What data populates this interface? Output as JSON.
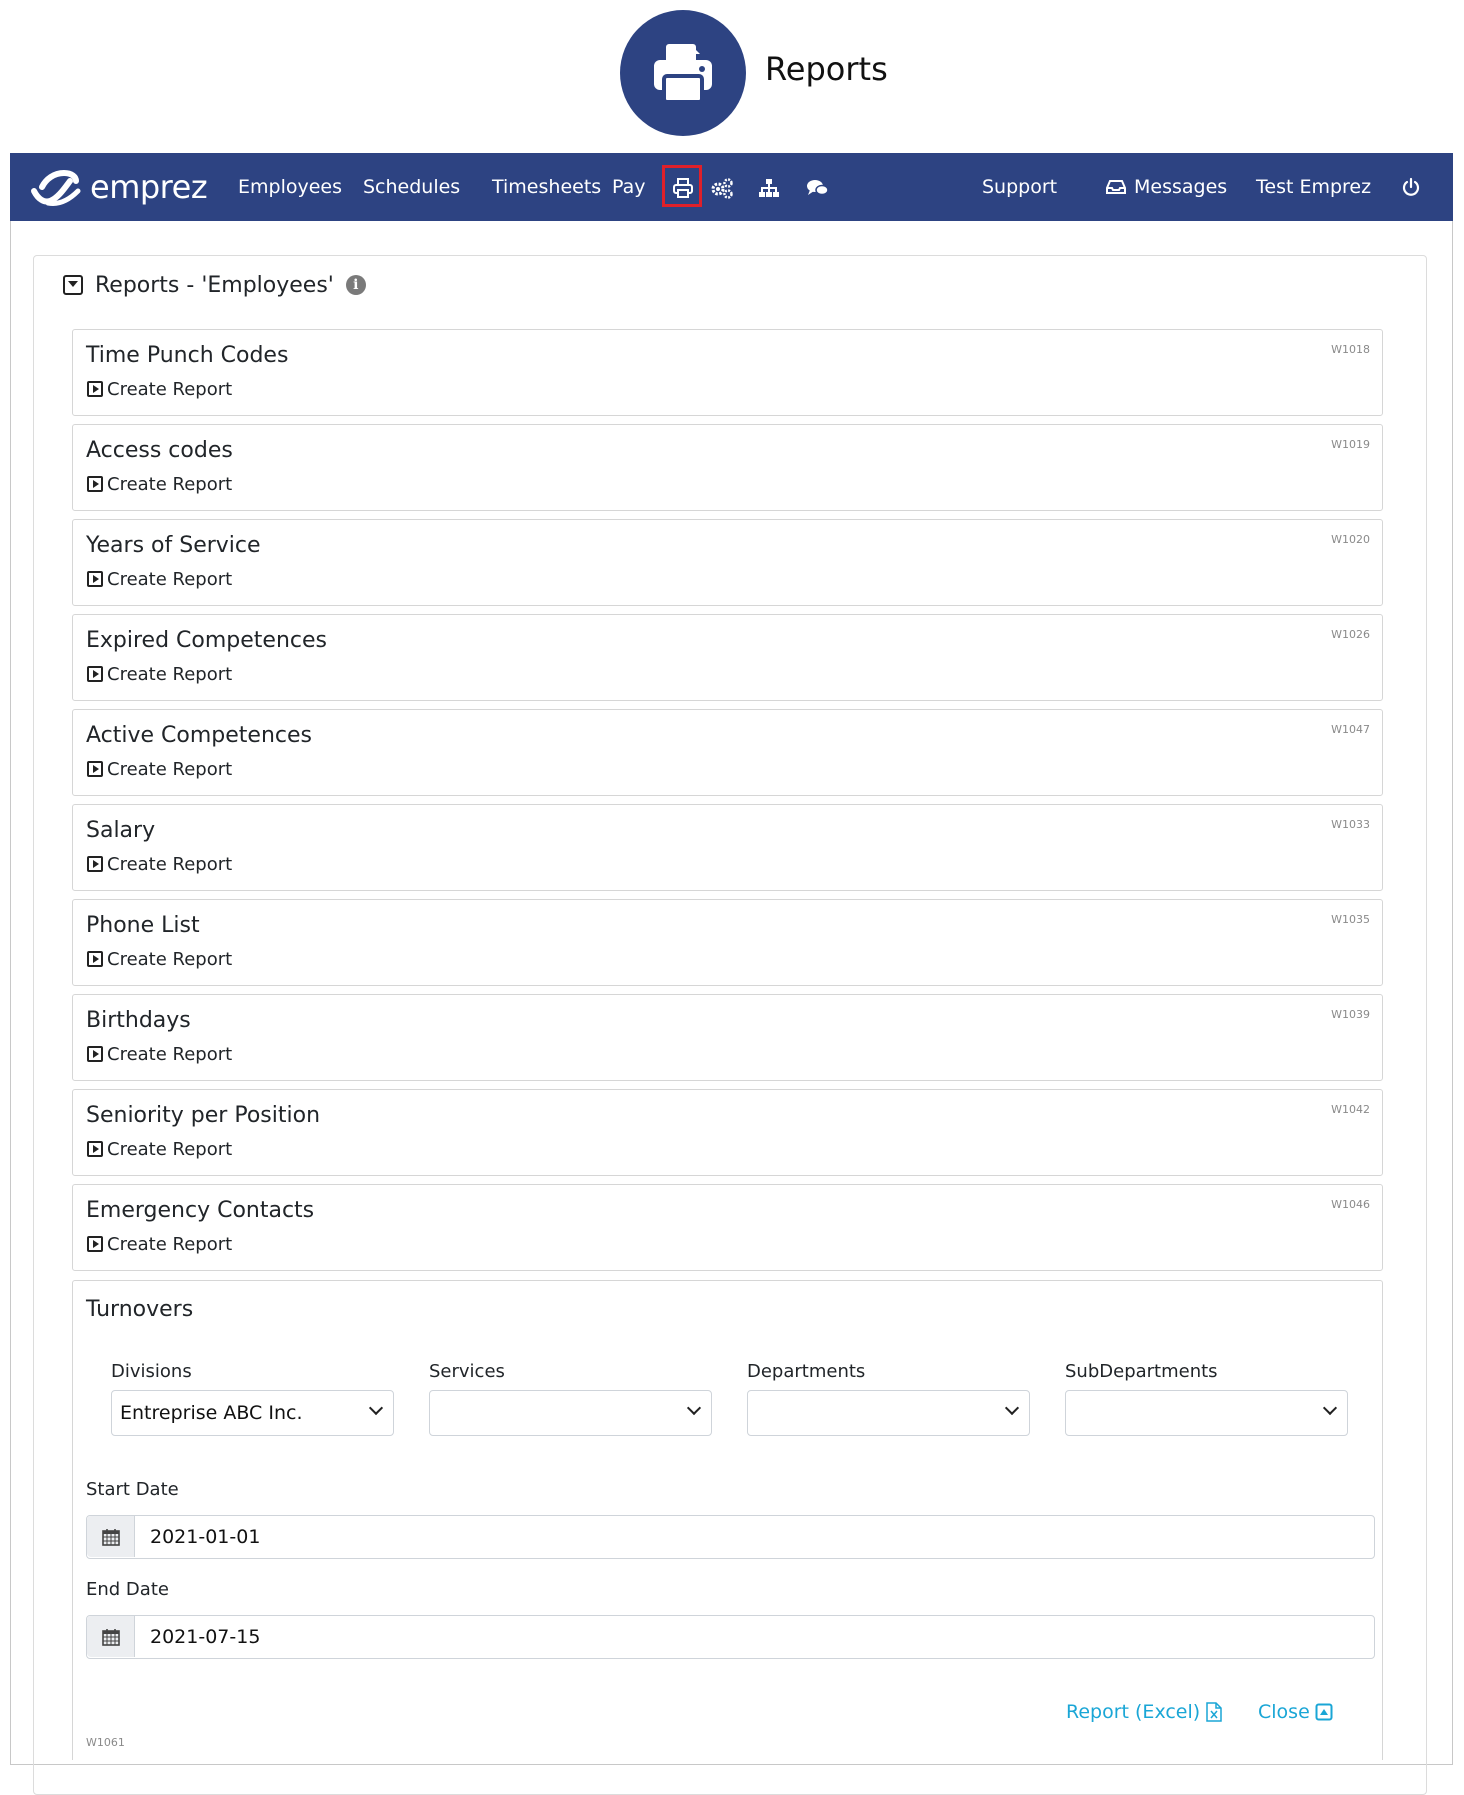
{
  "banner": {
    "title": "Reports",
    "icon": "printer-icon"
  },
  "navbar": {
    "brand": "emprez",
    "items": [
      "Employees",
      "Schedules",
      "Timesheets",
      "Pay"
    ],
    "icons": [
      "printer-icon",
      "cogs-icon",
      "sitemap-icon",
      "comments-icon"
    ],
    "highlighted_icon": "printer-icon",
    "support": "Support",
    "messages": "Messages",
    "user": "Test Emprez",
    "power_icon": "power-icon",
    "color": "#2d4382",
    "highlight_color": "#e0202a"
  },
  "panel": {
    "title": "Reports - 'Employees'"
  },
  "reports": [
    {
      "name": "Time Punch Codes",
      "code": "W1018",
      "action": "Create Report"
    },
    {
      "name": "Access codes",
      "code": "W1019",
      "action": "Create Report"
    },
    {
      "name": "Years of Service",
      "code": "W1020",
      "action": "Create Report"
    },
    {
      "name": "Expired Competences",
      "code": "W1026",
      "action": "Create Report"
    },
    {
      "name": "Active Competences",
      "code": "W1047",
      "action": "Create Report"
    },
    {
      "name": "Salary",
      "code": "W1033",
      "action": "Create Report"
    },
    {
      "name": "Phone List",
      "code": "W1035",
      "action": "Create Report"
    },
    {
      "name": "Birthdays",
      "code": "W1039",
      "action": "Create Report"
    },
    {
      "name": "Seniority per Position",
      "code": "W1042",
      "action": "Create Report"
    },
    {
      "name": "Emergency Contacts",
      "code": "W1046",
      "action": "Create Report"
    }
  ],
  "turnovers": {
    "title": "Turnovers",
    "filters": [
      {
        "label": "Divisions",
        "value": "Entreprise ABC Inc."
      },
      {
        "label": "Services",
        "value": ""
      },
      {
        "label": "Departments",
        "value": ""
      },
      {
        "label": "SubDepartments",
        "value": ""
      }
    ],
    "start_date_label": "Start Date",
    "start_date": "2021-01-01",
    "end_date_label": "End Date",
    "end_date": "2021-07-15",
    "report_excel": "Report (Excel)",
    "close": "Close",
    "code": "W1061",
    "link_color": "#1aa6d6"
  }
}
